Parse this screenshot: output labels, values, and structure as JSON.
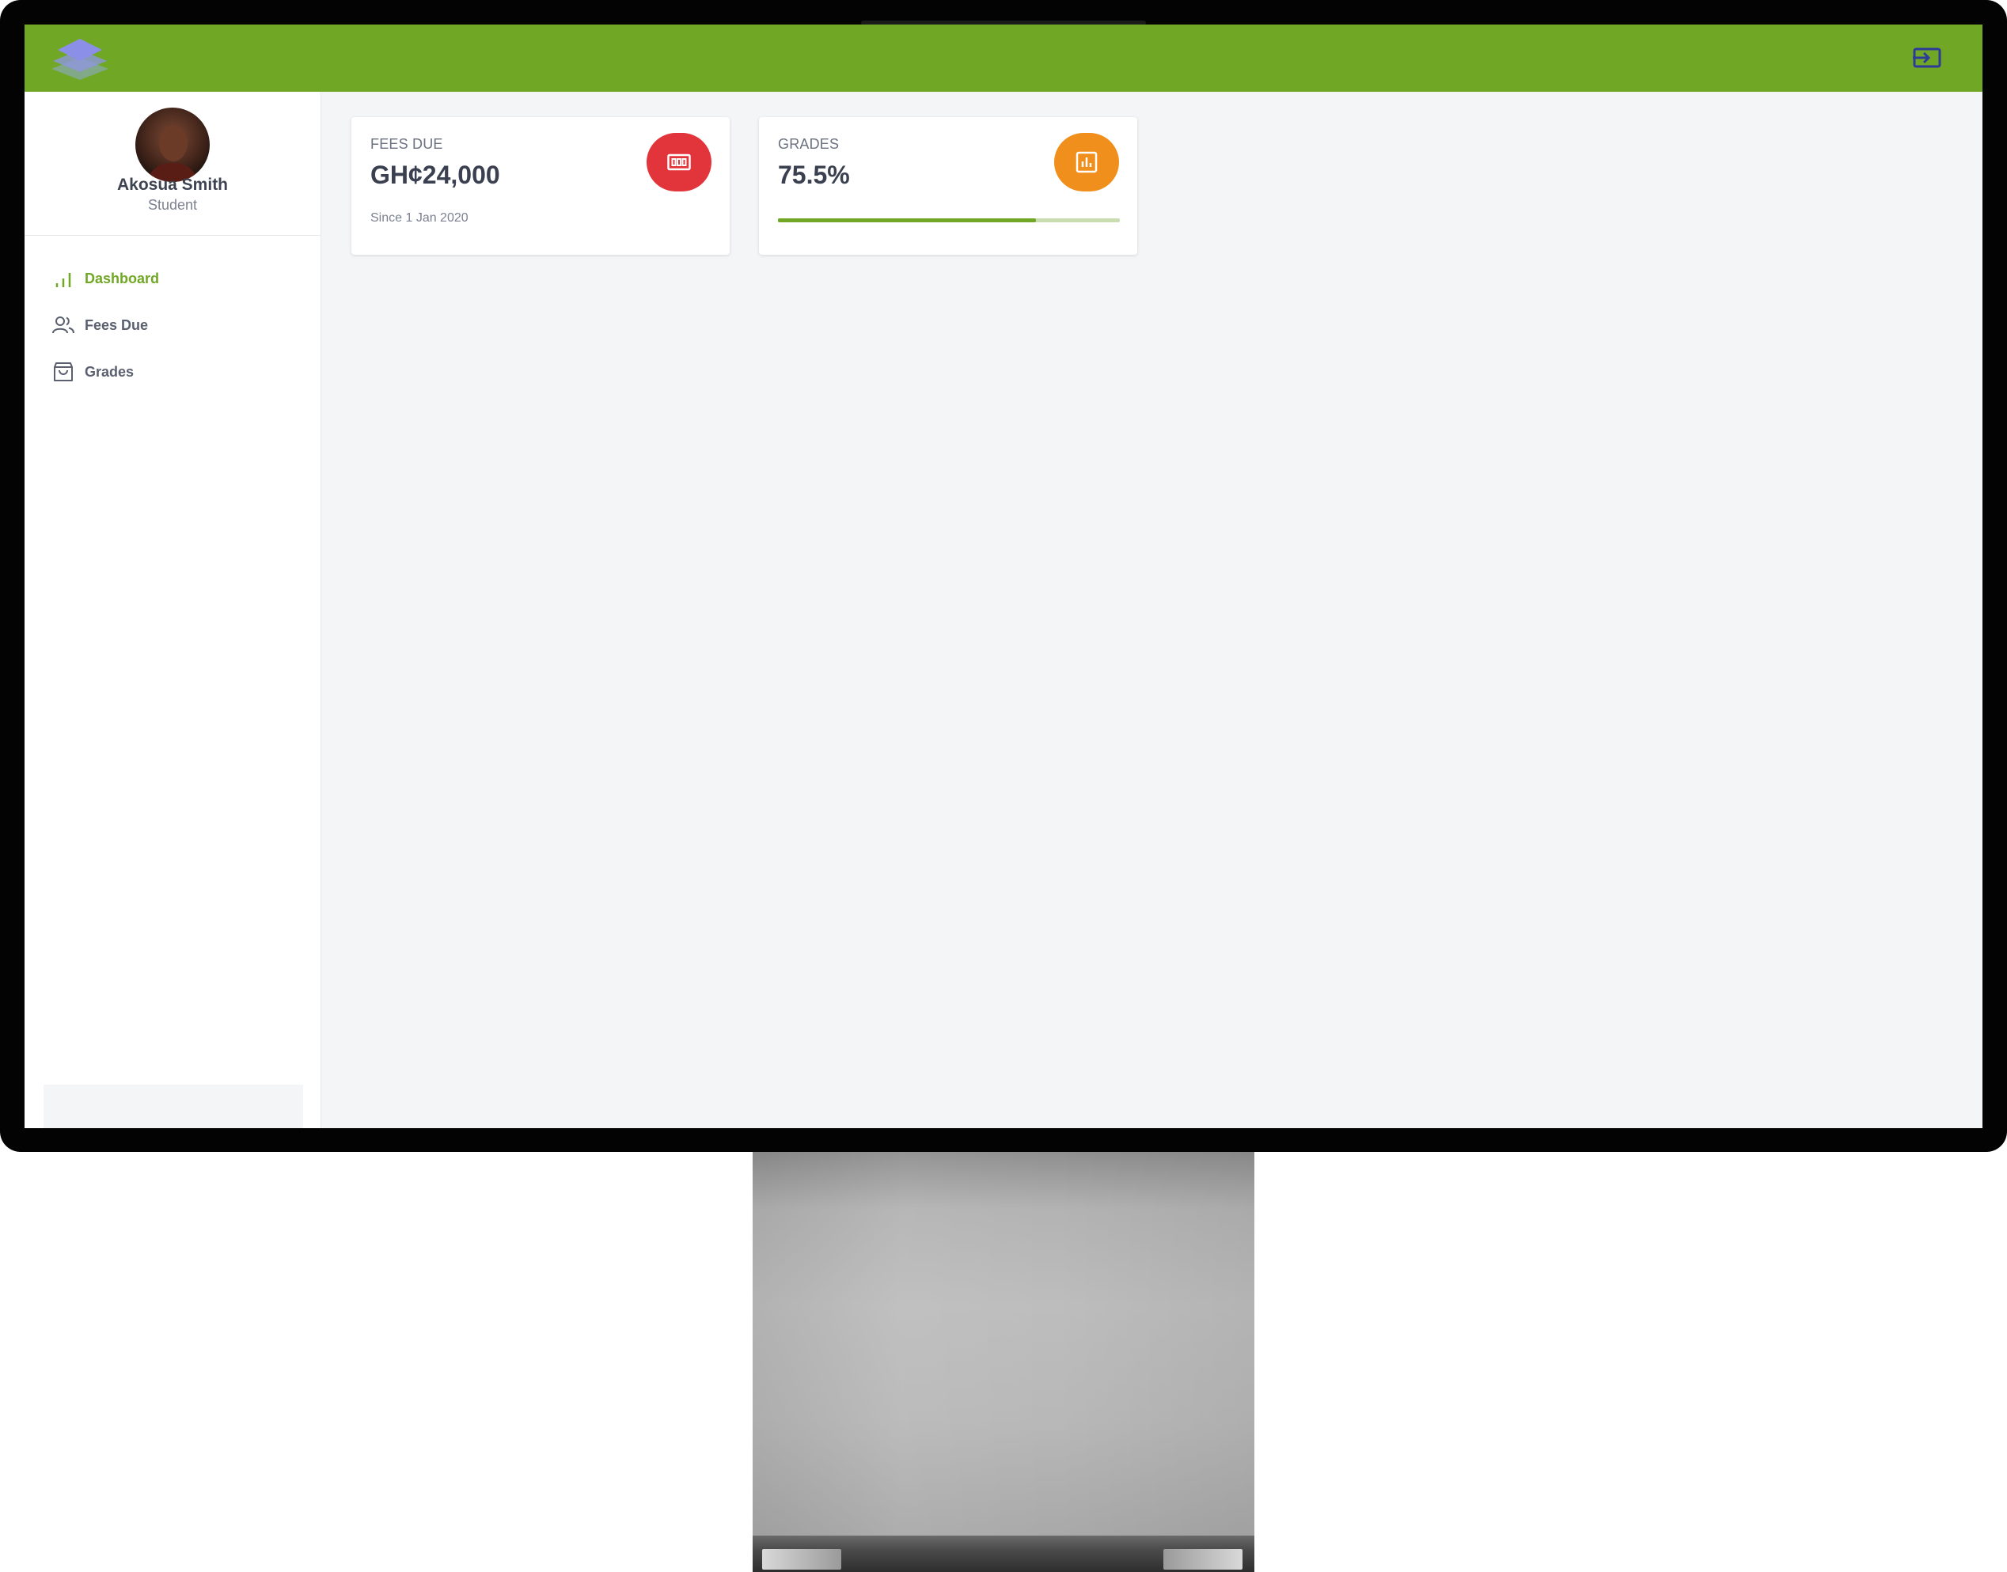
{
  "theme": {
    "brand": "#70a825",
    "fees_badge": "#e2343b",
    "grades_badge": "#f08f1c",
    "exit_icon": "#2e3a9a"
  },
  "topbar": {
    "logo_icon": "layers-logo-icon",
    "exit_icon": "log-out-icon"
  },
  "user": {
    "name": "Akosua Smith",
    "role": "Student"
  },
  "sidebar": {
    "items": [
      {
        "label": "Dashboard",
        "icon": "bar-chart-icon",
        "active": true
      },
      {
        "label": "Fees Due",
        "icon": "users-icon",
        "active": false
      },
      {
        "label": "Grades",
        "icon": "shopping-bag-icon",
        "active": false
      }
    ]
  },
  "cards": {
    "fees": {
      "title": "FEES DUE",
      "value": "GH¢24,000",
      "subtitle": "Since 1 Jan 2020",
      "icon": "money-icon"
    },
    "grades": {
      "title": "GRADES",
      "value": "75.5%",
      "progress": 0.755,
      "icon": "chart-icon"
    }
  }
}
